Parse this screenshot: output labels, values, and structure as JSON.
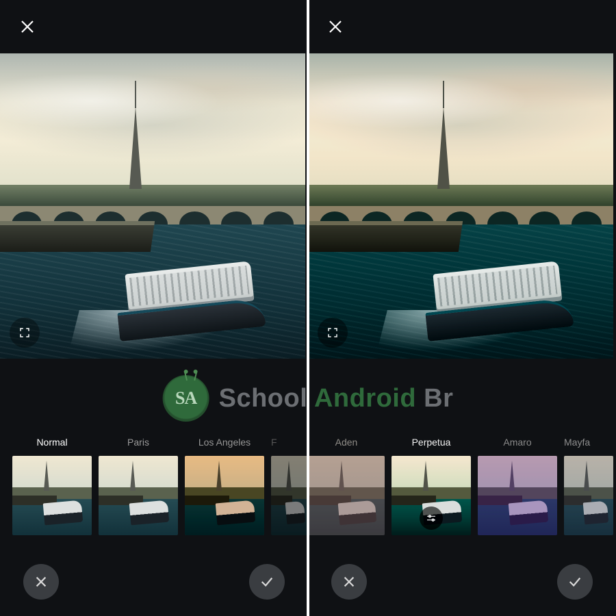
{
  "watermark": {
    "word1": "School ",
    "word2": "Android ",
    "word3": "Br",
    "badge": "SA"
  },
  "left": {
    "selected_filter": "Normal",
    "filters": [
      {
        "key": "normal",
        "label": "Normal",
        "selected": true,
        "style": ""
      },
      {
        "key": "paris",
        "label": "Paris",
        "selected": false,
        "style": ""
      },
      {
        "key": "la",
        "label": "Los Angeles",
        "selected": false,
        "style": "f-la"
      },
      {
        "key": "cut",
        "label": "F",
        "selected": false,
        "style": "f-dim",
        "narrow": true
      }
    ]
  },
  "right": {
    "selected_filter": "Perpetua",
    "preview_style": "f-perp",
    "filters": [
      {
        "key": "aden",
        "label": "Aden",
        "selected": false,
        "style": "f-aden"
      },
      {
        "key": "perpetua",
        "label": "Perpetua",
        "selected": true,
        "style": "f-perp",
        "adjust_badge": true
      },
      {
        "key": "amaro",
        "label": "Amaro",
        "selected": false,
        "style": "f-amaro"
      },
      {
        "key": "mayfa",
        "label": "Mayfa",
        "selected": false,
        "style": "f-mayfa",
        "narrow": true
      }
    ]
  },
  "icons": {
    "close": "close-icon",
    "expand": "expand-icon",
    "cancel": "cancel-icon",
    "confirm": "check-icon",
    "adjust": "sliders-icon"
  }
}
